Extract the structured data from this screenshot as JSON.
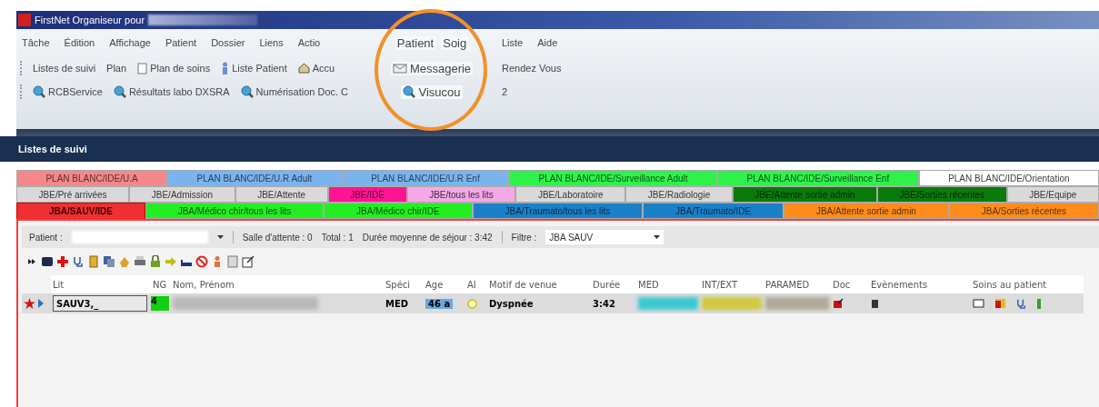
{
  "window": {
    "title": "FirstNet Organiseur pour"
  },
  "menu": [
    {
      "label": "Tâche",
      "magnified": false
    },
    {
      "label": "Édition",
      "magnified": false
    },
    {
      "label": "Affichage",
      "magnified": false
    },
    {
      "label": "Patient",
      "magnified": false
    },
    {
      "label": "Dossier",
      "magnified": false
    },
    {
      "label": "Liens",
      "magnified": false
    },
    {
      "label": "Actio",
      "magnified": false
    },
    {
      "label": "Patient",
      "magnified": true
    },
    {
      "label": "Soig",
      "magnified": true
    },
    {
      "label": "Liste",
      "magnified": false
    },
    {
      "label": "Aide",
      "magnified": false
    }
  ],
  "toolbar": [
    {
      "label": "Listes de suivi",
      "magnified": false
    },
    {
      "label": "Plan",
      "magnified": false
    },
    {
      "label": "Plan de soins",
      "magnified": false
    },
    {
      "label": "Liste Patient",
      "magnified": false
    },
    {
      "label": "Accu",
      "magnified": false
    },
    {
      "label": "Messagerie",
      "magnified": true
    },
    {
      "label": "Rendez Vous",
      "magnified": false
    }
  ],
  "links_toolbar": [
    {
      "label": "RCBService",
      "magnified": false
    },
    {
      "label": "Résultats labo DXSRA",
      "magnified": false
    },
    {
      "label": "Numérisation Doc. C",
      "magnified": false
    },
    {
      "label": "Visucou",
      "magnified": true
    },
    {
      "label": "2",
      "magnified": false
    }
  ],
  "section": {
    "title": "Listes de suivi"
  },
  "tab_rows": [
    [
      {
        "label": "PLAN BLANC/IDE/U.A",
        "color": "#f4878a",
        "selected": false
      },
      {
        "label": "PLAN BLANC/IDE/U.R Adult",
        "color": "#79b4ef",
        "selected": false
      },
      {
        "label": "PLAN BLANC/IDE/U.R Enf",
        "color": "#79b4ef",
        "selected": false
      },
      {
        "label": "PLAN BLANC/IDE/Surveillance Adult",
        "color": "#2ef24a",
        "selected": false
      },
      {
        "label": "PLAN BLANC/IDE/Surveillance Enf",
        "color": "#2ef24a",
        "selected": false
      },
      {
        "label": "PLAN BLANC/IDE/Orientation",
        "color": "#ffffff",
        "selected": false
      }
    ],
    [
      {
        "label": "JBE/Pré arrivées",
        "color": "#d9d9d9",
        "selected": false
      },
      {
        "label": "JBE/Admission",
        "color": "#d9d9d9",
        "selected": false
      },
      {
        "label": "JBE/Attente",
        "color": "#d9d9d9",
        "selected": false
      },
      {
        "label": "JBE/IDE",
        "color": "#ff1493",
        "selected": false
      },
      {
        "label": "JBE/tous les lits",
        "color": "#f5a8e6",
        "selected": false
      },
      {
        "label": "JBE/Laboratoire",
        "color": "#d9d9d9",
        "selected": false
      },
      {
        "label": "JBE/Radiologie",
        "color": "#d9d9d9",
        "selected": false
      },
      {
        "label": "JBE/Attente sortie admin",
        "color": "#0a7a0a",
        "selected": false
      },
      {
        "label": "JBE/Sorties récentes",
        "color": "#0a7a0a",
        "selected": false
      },
      {
        "label": "JBE/Equipe",
        "color": "#d9d9d9",
        "selected": false
      }
    ],
    [
      {
        "label": "JBA/SAUV/IDE",
        "color": "#f03030",
        "selected": true
      },
      {
        "label": "JBA/Médico chir/tous les lits",
        "color": "#22ee22",
        "selected": false
      },
      {
        "label": "JBA/Médico chir/IDE",
        "color": "#22ee22",
        "selected": false
      },
      {
        "label": "JBA/Traumato/tous les lits",
        "color": "#1b80c8",
        "selected": false
      },
      {
        "label": "JBA/Traumato/IDE",
        "color": "#1b80c8",
        "selected": false
      },
      {
        "label": "JBA/Attente sortie admin",
        "color": "#ff8c1a",
        "selected": false
      },
      {
        "label": "JBA/Sorties récentes",
        "color": "#ff8c1a",
        "selected": false
      }
    ]
  ],
  "filter_bar": {
    "patient_label": "Patient :",
    "waiting": "Salle d'attente : 0",
    "total": "Total : 1",
    "average_stay": "Durée moyenne de séjour : 3:42",
    "filter_label": "Filtre :",
    "filter_value": "JBA SAUV"
  },
  "table": {
    "columns": [
      "Lit",
      "NG",
      "Nom, Prénom",
      "Spéci",
      "Age",
      "AI",
      "Motif de venue",
      "Durée",
      "MED",
      "INT/EXT",
      "PARAMED",
      "Doc",
      "Evènements",
      "Soins au patient"
    ],
    "rows": [
      {
        "lit": "SAUV3,_",
        "ng": "4",
        "speciality": "MED",
        "age": "46 a",
        "reason": "Dyspnée",
        "duration": "3:42"
      }
    ]
  }
}
